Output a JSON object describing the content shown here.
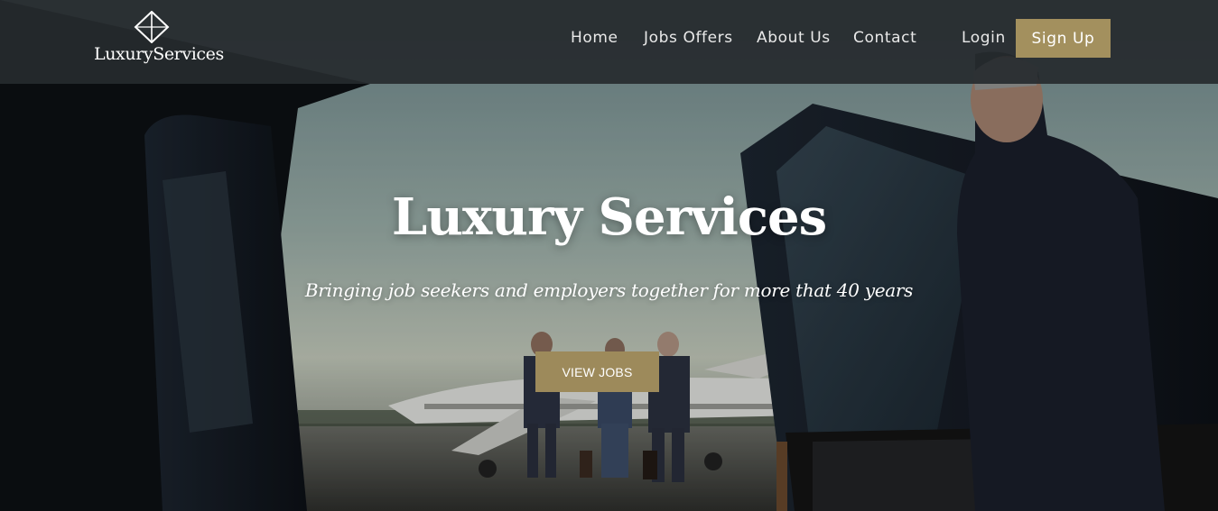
{
  "brand": {
    "name": "LuxuryServices"
  },
  "nav": {
    "items": [
      {
        "label": "Home"
      },
      {
        "label": "Jobs Offers"
      },
      {
        "label": "About Us"
      },
      {
        "label": "Contact"
      }
    ],
    "login_label": "Login",
    "signup_label": "Sign Up"
  },
  "hero": {
    "title": "Luxury Services",
    "subtitle": "Bringing job seekers and employers together for more that 40 years",
    "cta_label": "VIEW JOBS"
  },
  "colors": {
    "accent_gold": "#a3905e",
    "navbar_bg": "#262a2e",
    "text_light": "#ffffff"
  },
  "icons": {
    "logo": "diamond-icon"
  }
}
